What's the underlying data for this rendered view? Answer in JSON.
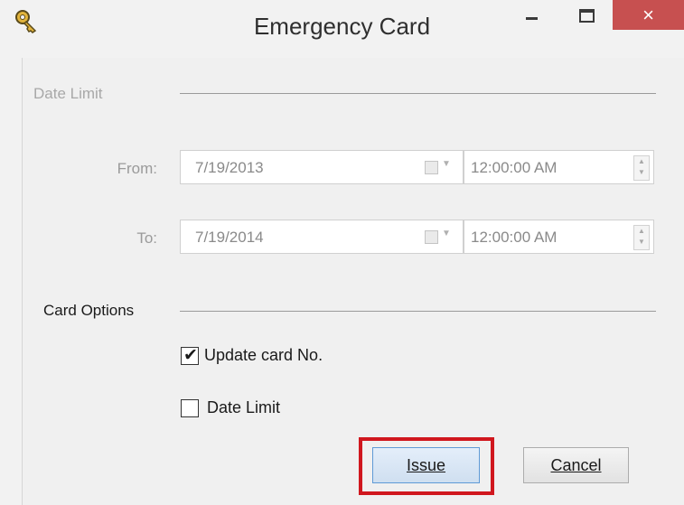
{
  "window": {
    "title": "Emergency Card",
    "close_glyph": "×",
    "app_icon": "key-icon"
  },
  "date_limit_section": {
    "label": "Date Limit",
    "from": {
      "label": "From:",
      "date": "7/19/2013",
      "time": "12:00:00 AM"
    },
    "to": {
      "label": "To:",
      "date": "7/19/2014",
      "time": "12:00:00 AM"
    }
  },
  "card_options_section": {
    "label": "Card Options",
    "update_card_no": {
      "label": "Update card No.",
      "checked": true
    },
    "date_limit": {
      "label": "Date Limit",
      "checked": false
    }
  },
  "buttons": {
    "issue_label": "Issue",
    "cancel_label": "Cancel"
  },
  "annotation_color": "#d0171e"
}
